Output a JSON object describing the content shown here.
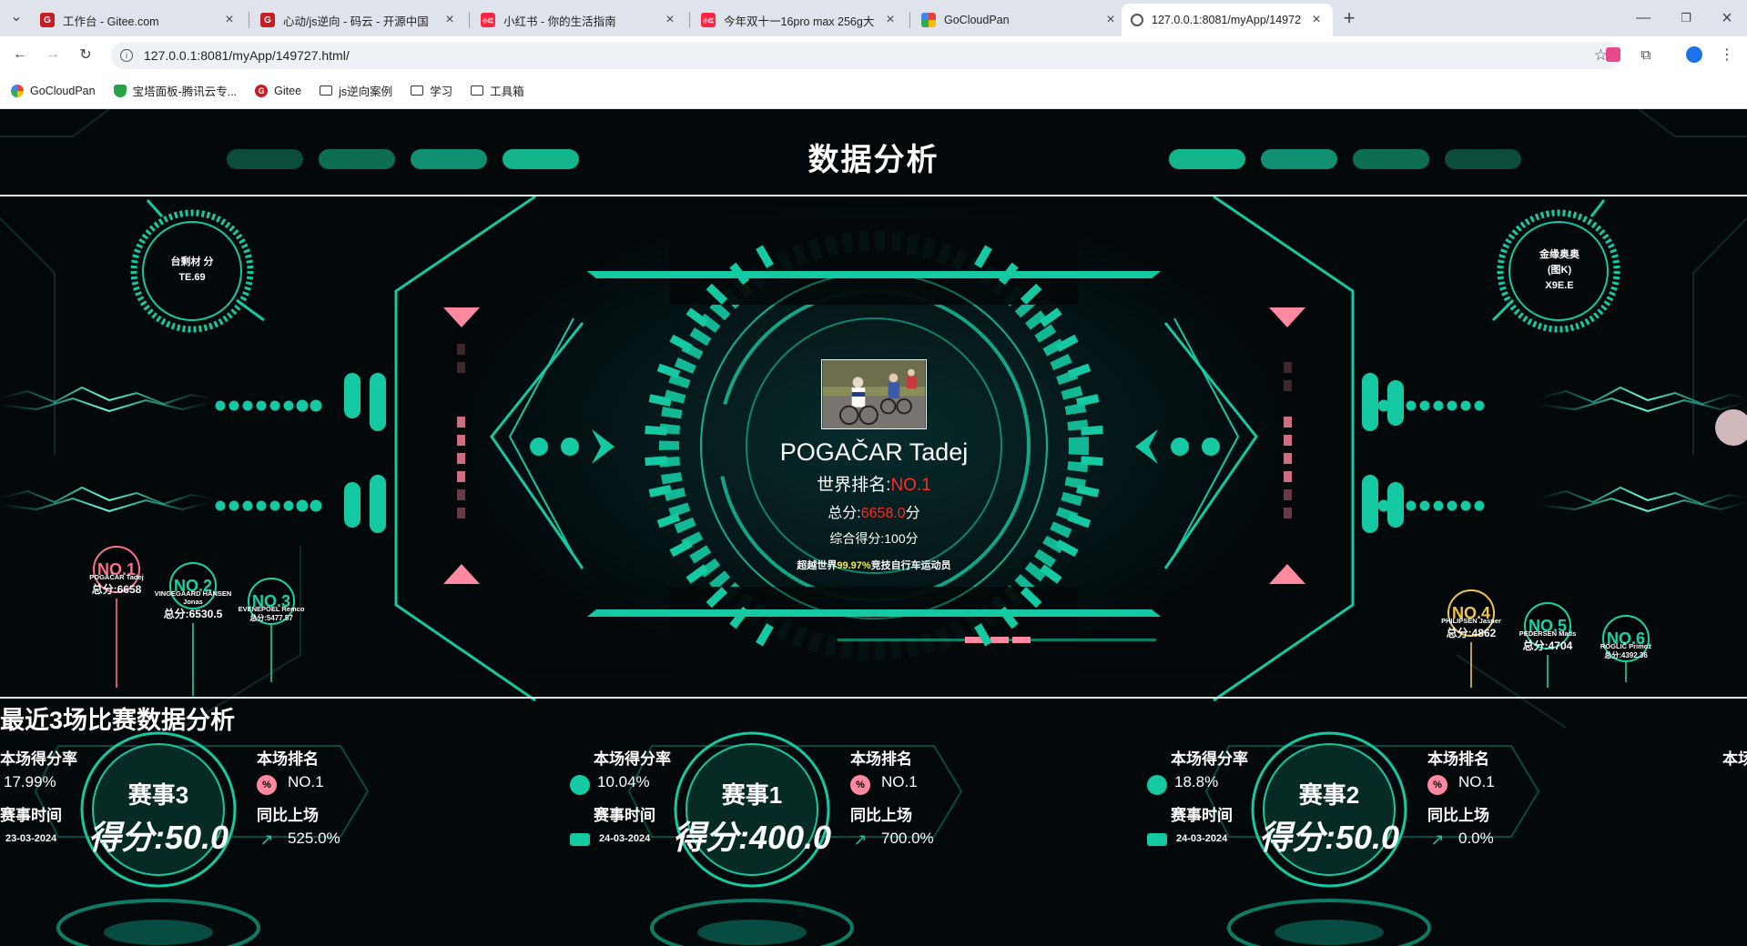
{
  "browser": {
    "tabs": [
      {
        "title": "工作台 - Gitee.com",
        "icon": "gitee-icon",
        "color": "#c71d23"
      },
      {
        "title": "心动/js逆向 - 码云 - 开源中国",
        "icon": "gitee-icon",
        "color": "#c71d23"
      },
      {
        "title": "小红书 - 你的生活指南",
        "icon": "xiaohongshu-icon",
        "color": "#ff2442"
      },
      {
        "title": "今年双十一16pro max 256g大",
        "icon": "xiaohongshu-icon",
        "color": "#ff2442"
      },
      {
        "title": "GoCloudPan",
        "icon": "gocloudpan-icon",
        "color": "#f5a623"
      },
      {
        "title": "127.0.0.1:8081/myApp/14972",
        "icon": "globe-icon",
        "color": "#555555"
      }
    ],
    "address": "127.0.0.1:8081/myApp/149727.html/",
    "bookmarks": [
      {
        "label": "GoCloudPan",
        "icon": "gocloudpan-icon"
      },
      {
        "label": "宝塔面板-腾讯云专...",
        "icon": "shield-icon"
      },
      {
        "label": "Gitee",
        "icon": "gitee-icon"
      },
      {
        "label": "js逆向案例",
        "icon": "folder-icon"
      },
      {
        "label": "学习",
        "icon": "folder-icon"
      },
      {
        "label": "工具箱",
        "icon": "folder-icon"
      }
    ]
  },
  "page": {
    "title": "数据分析",
    "top_left_ring": "台剩材 分TE.69",
    "top_right_ring": "金缘奥奥 (图K) X9E.E",
    "rider": {
      "name": "POGAČAR Tadej",
      "rank_label": "世界排名:",
      "rank_value": "NO.1",
      "total_label": "总分:",
      "total_value": "6658.0",
      "total_unit": "分",
      "composite": "综合得分:100分",
      "beat_prefix": "超越世界",
      "beat_value": "99.97%",
      "beat_suffix": "竞技自行车运动员"
    },
    "ranking": [
      {
        "no": "NO.1",
        "name": "POGAČAR Tadej",
        "score": "总分:6658",
        "color": "#ff6f8a"
      },
      {
        "no": "NO.2",
        "name": "VINGEGAARD HANSEN Jonas",
        "score": "总分:6530.5",
        "color": "#18d5a6"
      },
      {
        "no": "NO.3",
        "name": "EVENEPOEL Remco",
        "score": "总分:5477.57",
        "color": "#18d5a6"
      },
      {
        "no": "NO.4",
        "name": "PHILIPSEN Jasper",
        "score": "总分:4862",
        "color": "#f3c64a"
      },
      {
        "no": "NO.5",
        "name": "PEDERSEN Mads",
        "score": "总分:4704",
        "color": "#18d5a6"
      },
      {
        "no": "NO.6",
        "name": "ROGLIČ Primož",
        "score": "总分:4392.36",
        "color": "#18d5a6"
      }
    ],
    "section_title": "最近3场比赛数据分析",
    "labels": {
      "rate": "本场得分率",
      "rank": "本场排名",
      "time": "赛事时间",
      "yoy": "同比上场"
    },
    "matches": [
      {
        "event": "赛事3",
        "score": "得分:50.0",
        "rate": "17.99%",
        "rank": "NO.1",
        "date": "23-03-2024",
        "yoy": "525.0%"
      },
      {
        "event": "赛事1",
        "score": "得分:400.0",
        "rate": "10.04%",
        "rank": "NO.1",
        "date": "24-03-2024",
        "yoy": "700.0%"
      },
      {
        "event": "赛事2",
        "score": "得分:50.0",
        "rate": "18.8%",
        "rank": "NO.1",
        "date": "24-03-2024",
        "yoy": "0.0%"
      }
    ],
    "colors": {
      "accent": "#10c8a0",
      "pink": "#ff8aa0",
      "red": "#ff2a2a",
      "yellow": "#ffee33"
    }
  }
}
